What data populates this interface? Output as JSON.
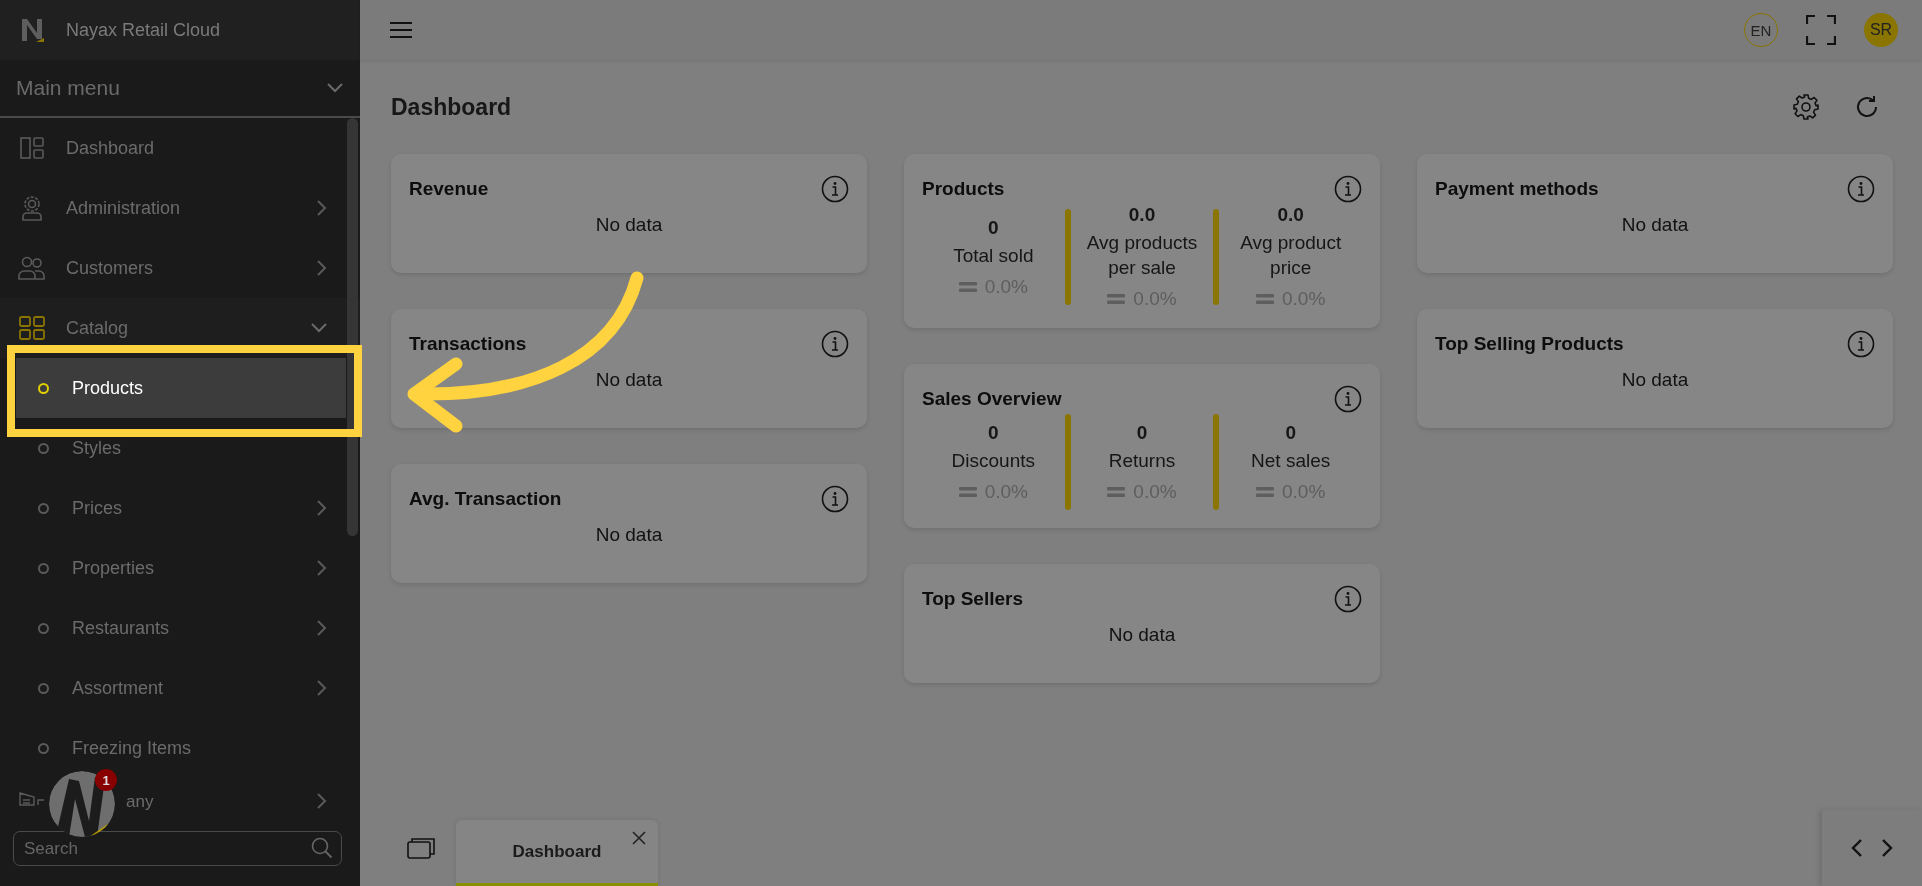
{
  "app": {
    "title": "Nayax Retail Cloud"
  },
  "sidebar": {
    "menu_title": "Main menu",
    "items": [
      {
        "label": "Dashboard",
        "has_submenu": false,
        "expanded": false,
        "selected": false
      },
      {
        "label": "Administration",
        "has_submenu": true,
        "expanded": false,
        "selected": false
      },
      {
        "label": "Customers",
        "has_submenu": true,
        "expanded": false,
        "selected": false
      },
      {
        "label": "Catalog",
        "has_submenu": true,
        "expanded": true,
        "selected": false,
        "children": [
          {
            "label": "Products",
            "has_submenu": false,
            "selected": true
          },
          {
            "label": "Styles",
            "has_submenu": false,
            "selected": false
          },
          {
            "label": "Prices",
            "has_submenu": true,
            "selected": false
          },
          {
            "label": "Properties",
            "has_submenu": true,
            "selected": false
          },
          {
            "label": "Restaurants",
            "has_submenu": true,
            "selected": false
          },
          {
            "label": "Assortment",
            "has_submenu": true,
            "selected": false
          },
          {
            "label": "Freezing Items",
            "has_submenu": false,
            "selected": false
          }
        ]
      },
      {
        "label": "any",
        "has_submenu": true,
        "expanded": false,
        "selected": false
      }
    ],
    "search": {
      "placeholder": "Search"
    }
  },
  "header": {
    "language": "EN",
    "user_initials": "SR"
  },
  "page": {
    "title": "Dashboard"
  },
  "columns": [
    [
      {
        "title": "Revenue",
        "kind": "empty",
        "message": "No data"
      },
      {
        "title": "Transactions",
        "kind": "empty",
        "message": "No data"
      },
      {
        "title": "Avg. Transaction",
        "kind": "empty",
        "message": "No data"
      }
    ],
    [
      {
        "title": "Products",
        "kind": "stats",
        "stats": [
          {
            "value": "0",
            "label": "Total sold",
            "change": "0.0%"
          },
          {
            "value": "0.0",
            "label": "Avg products per sale",
            "change": "0.0%"
          },
          {
            "value": "0.0",
            "label": "Avg product price",
            "change": "0.0%"
          }
        ]
      },
      {
        "title": "Sales Overview",
        "kind": "stats",
        "stats": [
          {
            "value": "0",
            "label": "Discounts",
            "change": "0.0%"
          },
          {
            "value": "0",
            "label": "Returns",
            "change": "0.0%"
          },
          {
            "value": "0",
            "label": "Net sales",
            "change": "0.0%"
          }
        ]
      },
      {
        "title": "Top Sellers",
        "kind": "empty",
        "message": "No data"
      }
    ],
    [
      {
        "title": "Payment methods",
        "kind": "empty",
        "message": "No data"
      },
      {
        "title": "Top Selling Products",
        "kind": "empty",
        "message": "No data"
      }
    ]
  ],
  "tabs": [
    {
      "label": "Dashboard",
      "selected": true
    }
  ],
  "launcher": {
    "badge": "1"
  }
}
